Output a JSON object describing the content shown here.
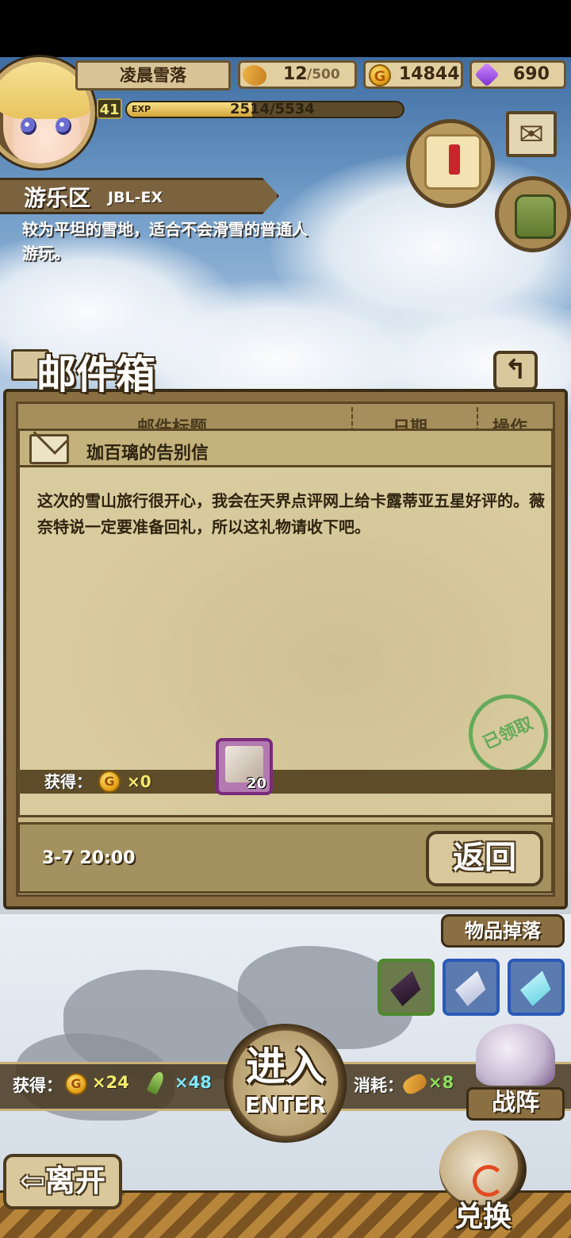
{
  "player": {
    "name": "凌晨雪落",
    "level": "41",
    "exp_tag": "EXP",
    "exp_text": "2514/5534",
    "exp_fraction": 0.454
  },
  "resources": {
    "stamina_current": "12",
    "stamina_max": "/500",
    "gold": "14844",
    "gold_symbol": "G",
    "gems": "690"
  },
  "area": {
    "name": "游乐区",
    "code": "JBL-EX",
    "description": "较为平坦的雪地，适合不会滑雪的普通人游玩。"
  },
  "mailbox": {
    "title": "邮件箱",
    "back_icon": "↰",
    "columns": [
      "邮件标题",
      "日期",
      "操作"
    ],
    "letter": {
      "title": "珈百璃的告别信",
      "body": "这次的雪山旅行很开心，我会在天界点评网上给卡露蒂亚五星好评的。薇奈特说一定要准备回礼，所以这礼物请收下吧。",
      "stamp": "已领取",
      "reward_label": "获得：",
      "reward_gold": "×0",
      "item_count": "20",
      "date": "3-7 20:00",
      "return_label": "返回"
    }
  },
  "stage": {
    "drops_label": "物品掉落",
    "gain_label": "获得：",
    "gain_gold": "×24",
    "gain_feather": "×48",
    "cost_label": "消耗：",
    "cost_stamina": "×8",
    "enter_cn": "进入",
    "enter_en": "ENTER",
    "team_label": "战阵",
    "leave_label": "离开",
    "leave_arrow": "⇦",
    "exchange_label": "兑换"
  },
  "colors": {
    "accent_gold": "#f5e96a",
    "accent_cyan": "#7fe6ff",
    "accent_green": "#8ee05a",
    "stamp_green": "#49a34b"
  }
}
